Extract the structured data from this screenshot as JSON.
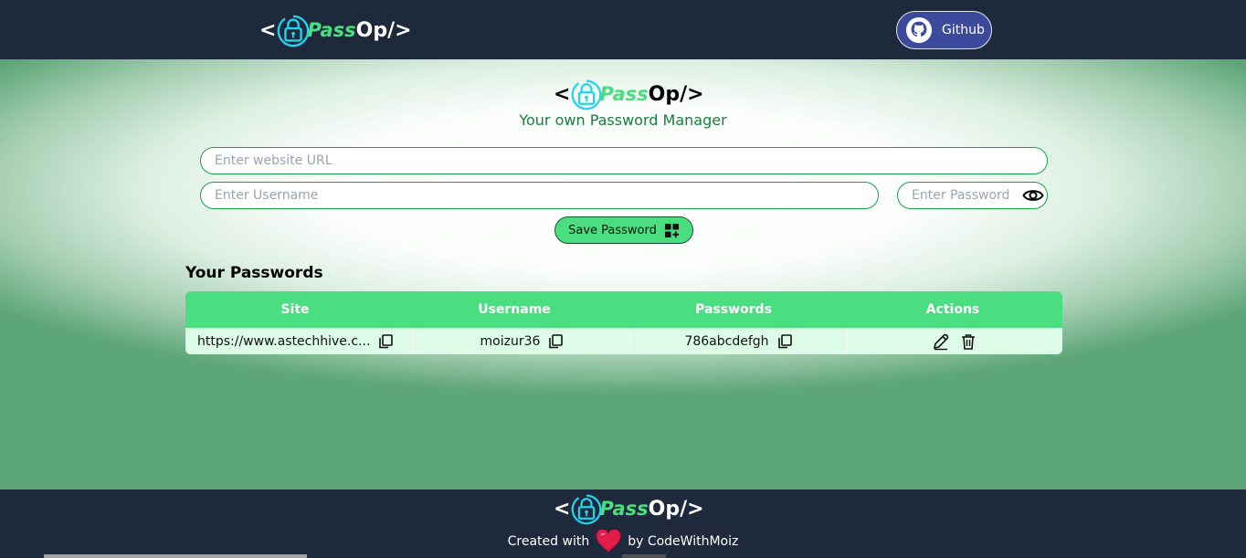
{
  "brand": {
    "open": "<",
    "pass": "Pass",
    "op": "Op/>"
  },
  "nav": {
    "github_label": "Github"
  },
  "hero": {
    "subtitle": "Your own Password Manager"
  },
  "form": {
    "url_placeholder": "Enter website URL",
    "username_placeholder": "Enter Username",
    "password_placeholder": "Enter Password",
    "save_label": "Save Password"
  },
  "passwords": {
    "heading": "Your Passwords",
    "columns": [
      "Site",
      "Username",
      "Passwords",
      "Actions"
    ],
    "rows": [
      {
        "site": "https://www.astechhive.c...",
        "username": "moizur36",
        "password": "786abcdefgh"
      }
    ]
  },
  "footer": {
    "created_prefix": "Created with",
    "created_suffix": "by CodeWithMoiz"
  },
  "colors": {
    "navy": "#1e293b",
    "green": "#4ade80",
    "dark_green": "#15803d",
    "row_bg": "#dcfce7"
  },
  "icons": [
    "lock-icon",
    "github-icon",
    "eye-icon",
    "add-icon",
    "copy-icon",
    "edit-icon",
    "delete-icon",
    "heart-icon"
  ]
}
